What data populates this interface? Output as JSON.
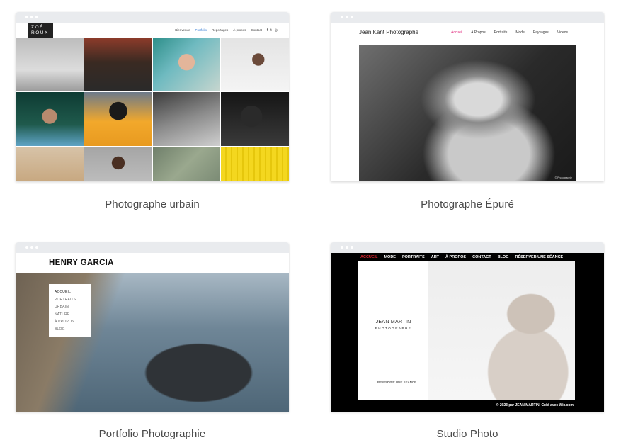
{
  "colors": {
    "chrome_bar": "#e9ebee",
    "caption_text": "#4a4a4a",
    "urbain_active_link": "#3b7fd6",
    "epure_active_link": "#e0267a",
    "studio_active_link": "#e0232e"
  },
  "templates": [
    {
      "caption": "Photographe urbain",
      "logo": [
        "ZOÉ",
        "ROUX"
      ],
      "nav": [
        "Bienvenue",
        "Portfolio",
        "Reportages",
        "À propos",
        "Contact"
      ],
      "social_icons": [
        "facebook-icon",
        "twitter-icon",
        "instagram-icon"
      ],
      "social_glyphs": [
        "f",
        "t",
        "◎"
      ]
    },
    {
      "caption": "Photographe Épuré",
      "site_title": "Jean Kant Photographe",
      "nav": [
        "Accueil",
        "À Propos",
        "Portraits",
        "Mode",
        "Paysages",
        "Videos"
      ],
      "credit": "© Photographie"
    },
    {
      "caption": "Portfolio Photographie",
      "site_title": "HENRY GARCIA",
      "menu": [
        "ACCUEIL",
        "PORTRAITS",
        "URBAIN",
        "NATURE",
        "À PROPOS",
        "BLOG"
      ]
    },
    {
      "caption": "Studio Photo",
      "nav": [
        "ACCUEIL",
        "MODE",
        "PORTRAITS",
        "ART",
        "À PROPOS",
        "CONTACT",
        "BLOG",
        "RÉSERVER UNE SÉANCE"
      ],
      "name": "JEAN MARTIN",
      "subtitle": "PHOTOGRAPHE",
      "cta": "RÉSERVER UNE SÉANCE",
      "footer": "© 2023 par JEAN MARTIN. Créé avec Wix.com"
    }
  ]
}
